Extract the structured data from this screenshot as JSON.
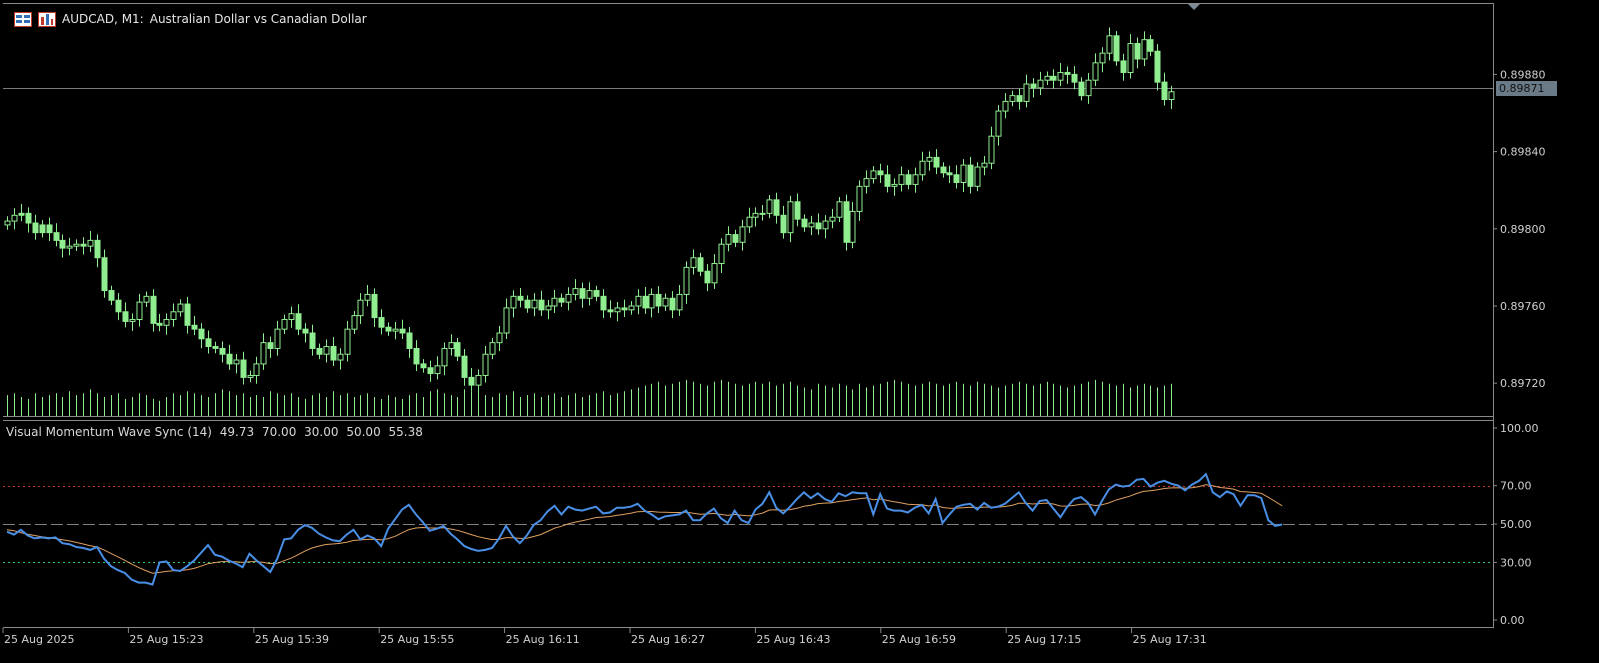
{
  "header": {
    "symbol": "AUDCAD, M1:",
    "description": "Australian Dollar vs Canadian Dollar",
    "icons": [
      "chart-grid-icon",
      "chart-bars-icon"
    ]
  },
  "indicator": {
    "name": "Visual Momentum Wave Sync (14)",
    "values": [
      "49.73",
      "70.00",
      "30.00",
      "50.00",
      "55.38"
    ]
  },
  "current_price": "0.89871",
  "colors": {
    "background": "#000000",
    "candle_up": "#90ee90",
    "candle_down": "#000000",
    "candle_outline": "#90ee90",
    "volume": "#90ee90",
    "momentum_line": "#4a8fe6",
    "signal_line": "#e0a060",
    "level_70": "#c0392b",
    "level_30": "#2ecc71",
    "level_50": "#808080"
  },
  "chart_data": [
    {
      "type": "candlestick",
      "title": "AUDCAD, M1:  Australian Dollar vs Canadian Dollar",
      "y_ticks": [
        "0.89880",
        "0.89840",
        "0.89800",
        "0.89760",
        "0.89720"
      ],
      "ylim": [
        0.89703,
        0.89917
      ],
      "x_ticks": [
        "25 Aug 2025",
        "25 Aug 15:23",
        "25 Aug 15:39",
        "25 Aug 15:55",
        "25 Aug 16:11",
        "25 Aug 16:27",
        "25 Aug 16:43",
        "25 Aug 16:59",
        "25 Aug 17:15",
        "25 Aug 17:31"
      ],
      "close": [
        0.89804,
        0.89807,
        0.89808,
        0.89803,
        0.89798,
        0.89802,
        0.89798,
        0.89794,
        0.8979,
        0.89791,
        0.89792,
        0.89791,
        0.89794,
        0.89785,
        0.89768,
        0.89763,
        0.89757,
        0.89752,
        0.89753,
        0.89762,
        0.89765,
        0.89751,
        0.8975,
        0.89753,
        0.89757,
        0.89761,
        0.8975,
        0.89748,
        0.89743,
        0.89739,
        0.89738,
        0.89735,
        0.8973,
        0.89732,
        0.89723,
        0.89724,
        0.8973,
        0.89741,
        0.89738,
        0.89748,
        0.89753,
        0.89756,
        0.89748,
        0.89746,
        0.89738,
        0.89735,
        0.89739,
        0.89732,
        0.89735,
        0.89748,
        0.89755,
        0.89763,
        0.89766,
        0.89754,
        0.89749,
        0.89747,
        0.89748,
        0.89746,
        0.89738,
        0.8973,
        0.89728,
        0.89725,
        0.89729,
        0.89738,
        0.89741,
        0.89734,
        0.89723,
        0.89719,
        0.89724,
        0.89735,
        0.89741,
        0.89746,
        0.89759,
        0.89765,
        0.89763,
        0.89759,
        0.89763,
        0.89758,
        0.8976,
        0.89764,
        0.89762,
        0.89766,
        0.89769,
        0.89764,
        0.89768,
        0.89765,
        0.89758,
        0.89757,
        0.89759,
        0.89758,
        0.8976,
        0.89765,
        0.89759,
        0.89766,
        0.8976,
        0.89764,
        0.89758,
        0.89766,
        0.8978,
        0.89785,
        0.89778,
        0.89772,
        0.89782,
        0.89792,
        0.89797,
        0.89793,
        0.89801,
        0.89806,
        0.89808,
        0.89808,
        0.89815,
        0.89807,
        0.89798,
        0.89814,
        0.89805,
        0.89801,
        0.89803,
        0.898,
        0.89804,
        0.89806,
        0.89814,
        0.89793,
        0.89809,
        0.89822,
        0.89826,
        0.8983,
        0.89828,
        0.89822,
        0.89823,
        0.89828,
        0.89823,
        0.89828,
        0.89835,
        0.89837,
        0.89832,
        0.89829,
        0.89828,
        0.89824,
        0.89833,
        0.89822,
        0.89832,
        0.89834,
        0.89848,
        0.89861,
        0.89866,
        0.89869,
        0.89866,
        0.89875,
        0.89873,
        0.89877,
        0.89879,
        0.89877,
        0.89881,
        0.8988,
        0.89876,
        0.89869,
        0.89877,
        0.89886,
        0.89891,
        0.899,
        0.89887,
        0.89881,
        0.89896,
        0.89888,
        0.89898,
        0.89892,
        0.89876,
        0.89867,
        0.89871
      ],
      "bullish": [
        true,
        true,
        false,
        false,
        false,
        false,
        false,
        false,
        false,
        true,
        true,
        false,
        true,
        false,
        false,
        false,
        false,
        false,
        true,
        true,
        true,
        false,
        false,
        true,
        true,
        true,
        false,
        false,
        false,
        false,
        false,
        false,
        false,
        true,
        false,
        true,
        true,
        true,
        false,
        true,
        true,
        true,
        false,
        false,
        false,
        false,
        true,
        false,
        true,
        true,
        true,
        true,
        true,
        false,
        false,
        false,
        true,
        false,
        false,
        false,
        false,
        false,
        true,
        true,
        true,
        false,
        false,
        false,
        true,
        true,
        true,
        true,
        true,
        true,
        false,
        false,
        true,
        false,
        true,
        true,
        false,
        true,
        true,
        false,
        true,
        false,
        false,
        false,
        true,
        false,
        true,
        true,
        false,
        true,
        false,
        true,
        false,
        true,
        true,
        true,
        false,
        false,
        true,
        true,
        true,
        false,
        true,
        true,
        true,
        false,
        true,
        false,
        false,
        true,
        false,
        false,
        true,
        false,
        true,
        true,
        true,
        false,
        true,
        true,
        true,
        true,
        false,
        false,
        true,
        true,
        false,
        true,
        true,
        true,
        false,
        false,
        false,
        false,
        true,
        false,
        true,
        true,
        true,
        true,
        true,
        true,
        false,
        true,
        false,
        true,
        true,
        false,
        true,
        false,
        false,
        false,
        true,
        true,
        true,
        true,
        false,
        false,
        true,
        false,
        true,
        false,
        false,
        false,
        true
      ],
      "volume_relative": [
        0.55,
        0.6,
        0.5,
        0.45,
        0.6,
        0.5,
        0.55,
        0.6,
        0.5,
        0.65,
        0.55,
        0.6,
        0.7,
        0.6,
        0.5,
        0.55,
        0.6,
        0.45,
        0.5,
        0.6,
        0.55,
        0.45,
        0.4,
        0.5,
        0.6,
        0.55,
        0.65,
        0.6,
        0.55,
        0.5,
        0.6,
        0.7,
        0.65,
        0.55,
        0.6,
        0.5,
        0.55,
        0.5,
        0.65,
        0.6,
        0.55,
        0.6,
        0.5,
        0.45,
        0.55,
        0.6,
        0.5,
        0.65,
        0.55,
        0.6,
        0.5,
        0.55,
        0.6,
        0.5,
        0.45,
        0.55,
        0.5,
        0.45,
        0.55,
        0.6,
        0.5,
        0.65,
        0.7,
        0.6,
        0.55,
        0.5,
        0.7,
        0.65,
        0.6,
        0.55,
        0.5,
        0.6,
        0.55,
        0.65,
        0.5,
        0.55,
        0.6,
        0.5,
        0.55,
        0.6,
        0.5,
        0.55,
        0.6,
        0.5,
        0.55,
        0.6,
        0.65,
        0.55,
        0.6,
        0.65,
        0.7,
        0.75,
        0.8,
        0.85,
        0.9,
        0.8,
        0.85,
        0.9,
        0.95,
        0.9,
        0.85,
        0.8,
        0.9,
        0.95,
        0.9,
        0.85,
        0.8,
        0.85,
        0.9,
        0.85,
        0.9,
        0.8,
        0.85,
        0.9,
        0.8,
        0.75,
        0.7,
        0.85,
        0.8,
        0.75,
        0.85,
        0.8,
        0.7,
        0.85,
        0.75,
        0.8,
        0.85,
        0.9,
        0.95,
        0.9,
        0.85,
        0.8,
        0.85,
        0.9,
        0.85,
        0.8,
        0.85,
        0.9,
        0.85,
        0.8,
        0.9,
        0.85,
        0.8,
        0.75,
        0.8,
        0.85,
        0.9,
        0.85,
        0.8,
        0.85,
        0.9,
        0.85,
        0.8,
        0.75,
        0.8,
        0.85,
        0.9,
        0.95,
        0.9,
        0.85,
        0.8,
        0.85,
        0.75,
        0.8,
        0.85,
        0.8,
        0.75,
        0.8,
        0.85
      ]
    },
    {
      "type": "line",
      "title": "Visual Momentum Wave Sync (14)",
      "y_ticks": [
        "100.00",
        "70.00",
        "50.00",
        "30.00",
        "0.00"
      ],
      "ylim": [
        0,
        100
      ],
      "levels": [
        70,
        50,
        30
      ],
      "series": [
        {
          "name": "momentum",
          "values": [
            46.0,
            44.5,
            47.0,
            44.0,
            42.5,
            43.0,
            42.5,
            43.0,
            40.0,
            39.5,
            38.0,
            37.5,
            36.5,
            38.0,
            32.0,
            28.0,
            26.0,
            24.5,
            21.0,
            19.5,
            19.5,
            18.5,
            30.0,
            30.5,
            26.0,
            25.5,
            28.0,
            31.0,
            35.0,
            39.0,
            34.0,
            33.0,
            31.0,
            29.5,
            27.5,
            34.5,
            31.0,
            28.0,
            25.0,
            32.0,
            42.0,
            42.5,
            47.0,
            49.5,
            48.0,
            45.0,
            43.0,
            41.5,
            41.0,
            44.5,
            47.0,
            42.0,
            44.0,
            42.5,
            38.5,
            47.5,
            52.5,
            57.5,
            60.0,
            55.0,
            51.0,
            46.5,
            47.5,
            49.0,
            45.0,
            42.0,
            38.5,
            37.0,
            36.0,
            36.5,
            37.5,
            42.5,
            49.0,
            43.5,
            40.0,
            44.0,
            49.5,
            52.0,
            56.5,
            59.5,
            55.0,
            59.0,
            57.5,
            57.0,
            58.0,
            59.0,
            55.5,
            56.0,
            58.5,
            58.5,
            59.0,
            60.5,
            57.0,
            55.0,
            52.5,
            54.0,
            54.5,
            55.0,
            57.0,
            52.0,
            52.0,
            55.5,
            58.0,
            53.0,
            50.5,
            57.0,
            52.0,
            50.5,
            57.5,
            60.5,
            66.5,
            58.5,
            55.5,
            59.0,
            63.0,
            66.5,
            63.5,
            66.0,
            63.0,
            61.5,
            66.0,
            64.5,
            66.5,
            66.0,
            66.0,
            55.0,
            65.5,
            58.0,
            57.0,
            57.0,
            56.0,
            58.5,
            60.0,
            55.5,
            63.0,
            50.5,
            55.0,
            59.0,
            60.0,
            60.5,
            57.5,
            61.0,
            58.5,
            59.0,
            60.5,
            63.5,
            66.5,
            61.0,
            57.0,
            62.0,
            62.5,
            58.0,
            53.5,
            59.0,
            63.0,
            64.0,
            61.0,
            55.0,
            62.0,
            68.0,
            70.5,
            69.5,
            70.0,
            73.0,
            73.5,
            69.5,
            71.5,
            72.5,
            71.0,
            70.0,
            67.5,
            70.5,
            72.5,
            76.0,
            66.5,
            64.0,
            67.0,
            65.5,
            59.5,
            65.0,
            65.0,
            63.5,
            52.0,
            49.0,
            49.73
          ]
        },
        {
          "name": "signal",
          "values": [
            47.0,
            46.5,
            45.5,
            44.7,
            44.0,
            43.4,
            42.9,
            42.4,
            41.8,
            41.2,
            40.4,
            39.6,
            38.7,
            38.0,
            36.5,
            34.7,
            32.9,
            31.1,
            29.1,
            27.3,
            25.8,
            24.4,
            24.8,
            25.3,
            25.7,
            25.8,
            26.2,
            26.9,
            28.0,
            29.3,
            29.9,
            30.4,
            30.4,
            30.3,
            30.0,
            30.3,
            30.4,
            30.0,
            29.4,
            29.6,
            30.9,
            32.2,
            34.0,
            35.9,
            37.5,
            38.5,
            39.3,
            39.6,
            39.9,
            40.5,
            41.4,
            41.7,
            42.0,
            42.1,
            41.7,
            42.4,
            43.6,
            45.4,
            47.1,
            47.9,
            48.2,
            47.9,
            47.9,
            48.0,
            47.4,
            46.7,
            45.6,
            44.5,
            43.4,
            42.6,
            41.9,
            42.0,
            42.9,
            42.8,
            42.5,
            42.6,
            43.5,
            44.5,
            46.1,
            47.8,
            48.8,
            50.1,
            51.0,
            51.7,
            52.5,
            53.4,
            53.6,
            53.9,
            54.5,
            55.0,
            55.6,
            56.4,
            56.5,
            56.5,
            56.2,
            56.1,
            56.0,
            56.0,
            56.2,
            55.6,
            55.1,
            55.2,
            55.5,
            55.0,
            54.5,
            55.0,
            54.6,
            54.2,
            54.8,
            55.7,
            57.3,
            57.4,
            57.2,
            57.5,
            58.2,
            59.2,
            59.8,
            60.6,
            60.9,
            61.0,
            61.7,
            62.1,
            62.7,
            63.2,
            63.6,
            62.6,
            63.0,
            62.3,
            61.6,
            61.0,
            60.3,
            60.1,
            60.1,
            59.4,
            59.9,
            58.6,
            58.2,
            58.3,
            58.5,
            58.7,
            58.5,
            58.8,
            58.8,
            58.8,
            59.1,
            59.7,
            60.8,
            60.8,
            60.4,
            60.7,
            60.9,
            60.4,
            59.4,
            59.3,
            59.7,
            60.3,
            60.4,
            59.6,
            60.0,
            61.0,
            62.4,
            63.5,
            64.5,
            65.9,
            67.0,
            67.3,
            67.8,
            68.5,
            68.8,
            68.9,
            68.6,
            68.9,
            69.5,
            70.5,
            69.9,
            69.0,
            68.7,
            68.2,
            66.9,
            66.7,
            66.4,
            66.0,
            63.9,
            61.7,
            59.5
          ]
        }
      ]
    }
  ]
}
